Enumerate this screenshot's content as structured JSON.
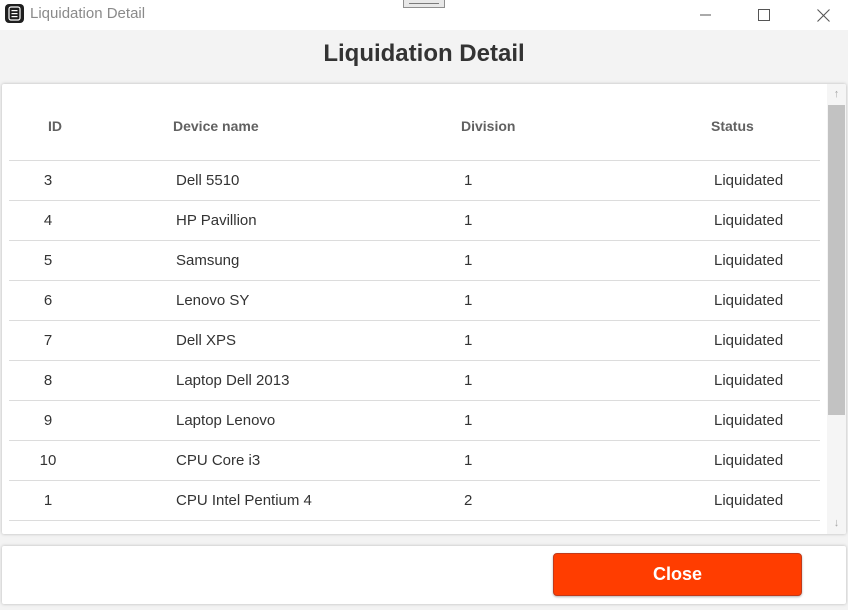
{
  "window": {
    "title": "Liquidation Detail",
    "icons": {
      "app": "app-icon",
      "minimize": "minimize-icon",
      "maximize": "maximize-icon",
      "close": "close-icon"
    }
  },
  "heading": "Liquidation Detail",
  "table": {
    "columns": [
      "ID",
      "Device name",
      "Division",
      "Status"
    ],
    "rows": [
      {
        "id": "3",
        "name": "Dell 5510",
        "division": "1",
        "status": "Liquidated"
      },
      {
        "id": "4",
        "name": "HP Pavillion",
        "division": "1",
        "status": "Liquidated"
      },
      {
        "id": "5",
        "name": "Samsung",
        "division": "1",
        "status": "Liquidated"
      },
      {
        "id": "6",
        "name": "Lenovo SY",
        "division": "1",
        "status": "Liquidated"
      },
      {
        "id": "7",
        "name": "Dell XPS",
        "division": "1",
        "status": "Liquidated"
      },
      {
        "id": "8",
        "name": "Laptop Dell 2013",
        "division": "1",
        "status": "Liquidated"
      },
      {
        "id": "9",
        "name": "Laptop Lenovo",
        "division": "1",
        "status": "Liquidated"
      },
      {
        "id": "10",
        "name": "CPU Core i3",
        "division": "1",
        "status": "Liquidated"
      },
      {
        "id": "1",
        "name": "CPU Intel Pentium 4",
        "division": "2",
        "status": "Liquidated"
      }
    ]
  },
  "footer": {
    "close_label": "Close"
  },
  "colors": {
    "accent": "#ff3d00",
    "header_text": "#616161",
    "body_text": "#333333"
  }
}
